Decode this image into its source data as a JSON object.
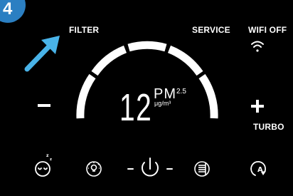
{
  "step_number": "4",
  "labels": {
    "filter": "FILTER",
    "service": "SERVICE",
    "wifi": "WIFI OFF",
    "turbo": "TURBO"
  },
  "display": {
    "reading": "12",
    "pollutant": "PM",
    "pollutant_size": "2.5",
    "unit": "μg/m³"
  },
  "indicator": {
    "arrow_color": "#49b3e8",
    "points_to": "filter"
  },
  "controls": {
    "minus_symbol": "–",
    "plus_symbol": "+"
  },
  "icons": [
    "sleep-icon",
    "light-icon",
    "power-icon",
    "filter-icon",
    "auto-icon",
    "wifi-icon"
  ],
  "colors": {
    "background": "#000000",
    "foreground": "#ffffff",
    "badge": "#2b7fc2"
  }
}
